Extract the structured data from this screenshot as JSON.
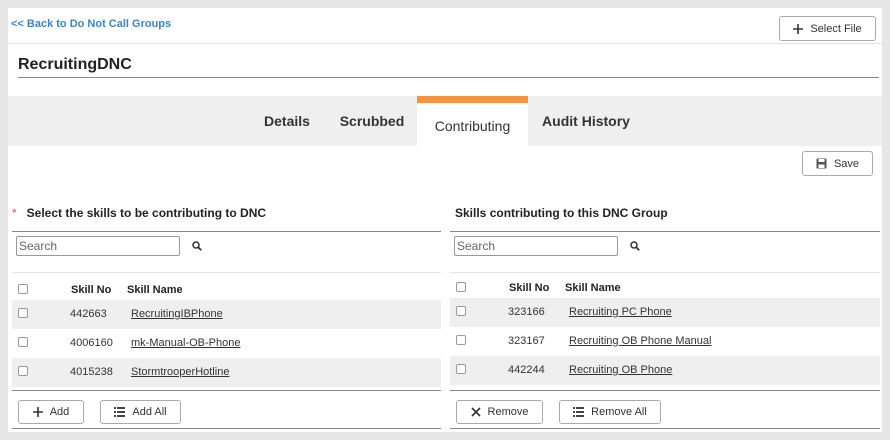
{
  "header": {
    "back_link": "<< Back to Do Not Call Groups",
    "select_file_label": "Select File",
    "title": "RecruitingDNC"
  },
  "tabs": [
    {
      "label": "Details",
      "active": false
    },
    {
      "label": "Scrubbed",
      "active": false
    },
    {
      "label": "Contributing",
      "active": true
    },
    {
      "label": "Audit History",
      "active": false
    }
  ],
  "save_label": "Save",
  "colors": {
    "accent": "#f7933c",
    "link": "#3b86c6",
    "required": "#d9534f"
  },
  "left_panel": {
    "required_mark": "*",
    "title": "Select the skills to be contributing to DNC",
    "search_placeholder": "Search",
    "columns": [
      "Skill No",
      "Skill Name"
    ],
    "rows": [
      {
        "skill_no": "442663",
        "skill_name": "RecruitingIBPhone"
      },
      {
        "skill_no": "4006160",
        "skill_name": "mk-Manual-OB-Phone"
      },
      {
        "skill_no": "4015238",
        "skill_name": "StormtrooperHotline"
      }
    ],
    "add_label": "Add",
    "add_all_label": "Add All"
  },
  "right_panel": {
    "title": "Skills contributing to this DNC Group",
    "search_placeholder": "Search",
    "columns": [
      "Skill No",
      "Skill Name"
    ],
    "rows": [
      {
        "skill_no": "323166",
        "skill_name": "Recruiting PC Phone"
      },
      {
        "skill_no": "323167",
        "skill_name": "Recruiting OB Phone Manual"
      },
      {
        "skill_no": "442244",
        "skill_name": "Recruiting OB Phone"
      }
    ],
    "remove_label": "Remove",
    "remove_all_label": "Remove All"
  }
}
